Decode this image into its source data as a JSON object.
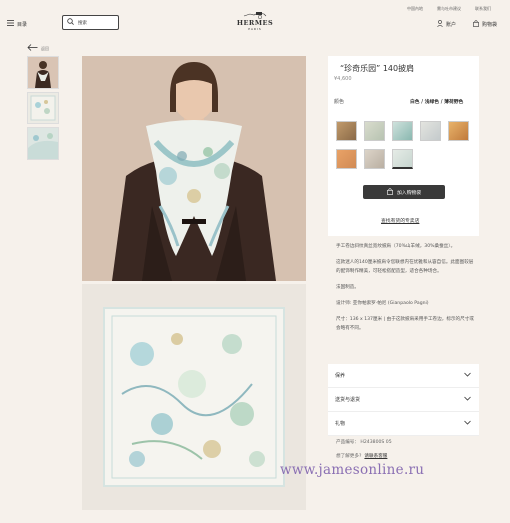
{
  "topbar": {
    "links": [
      "中国內地",
      "需与吐市建议",
      "联系我们"
    ]
  },
  "header": {
    "menu_label": "目录",
    "search_placeholder": "搜索",
    "logo_name": "HERMES",
    "logo_city": "PARIS",
    "account_label": "账户",
    "cart_label": "购物袋"
  },
  "back_label": "返回",
  "product": {
    "title": "“珍奇乐园” 140披肩",
    "price": "¥4,600",
    "color_label": "颜色",
    "color_value": "白色 / 浅绿色 / 薄荷野色",
    "add_to_cart": "加入购物袋",
    "find_store": "查找有货的专卖店",
    "description": [
      "手工卷边斜纹真丝宽纹披肩（70%山羊绒，30%桑蚕丝）。",
      "这款迷人的140厘米披肩令您联想内在优雅和从容自信。此面图较层的配饰制作精美，可轻松搭配造型，适合各种场合。",
      "法国制造。",
      "设计师: 亚你帕索罗·帕尼 (Gianpaolo Pagni)",
      "尺寸：136 x 137厘米 | 由于这款披肩采用手工卷边，标示的尺寸或会略有不同。"
    ]
  },
  "accordion": {
    "items": [
      "保养",
      "送货与退货",
      "礼物"
    ]
  },
  "product_meta": {
    "sku": "产品编号：   H243800S 05",
    "more_question": "想了解更多?",
    "contact_link": "请联系客服"
  },
  "colors": {
    "background": "#f6f1eb",
    "button_dark": "#3a3a3a",
    "watermark": "#8a6fb3"
  },
  "watermark": "www.jamesonline.ru"
}
